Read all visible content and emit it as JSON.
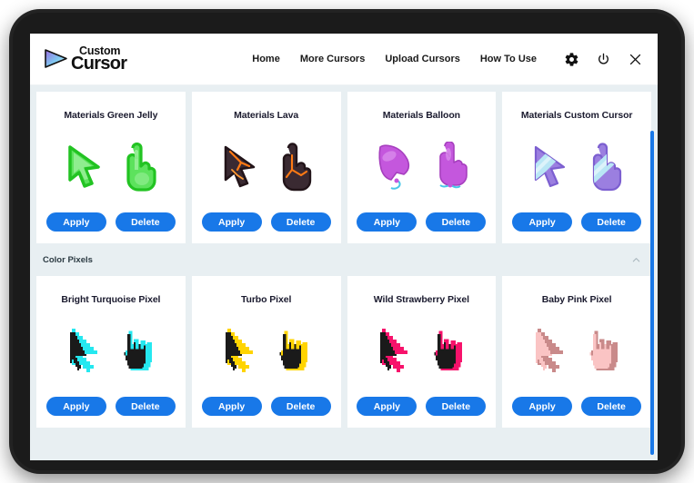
{
  "app": {
    "logo_top": "Custom",
    "logo_bottom": "Cursor"
  },
  "nav": {
    "links": [
      {
        "label": "Home"
      },
      {
        "label": "More Cursors"
      },
      {
        "label": "Upload Cursors"
      },
      {
        "label": "How To Use"
      }
    ],
    "icons": [
      {
        "name": "gear-icon"
      },
      {
        "name": "power-icon"
      },
      {
        "name": "close-icon"
      }
    ]
  },
  "buttons": {
    "apply": "Apply",
    "delete": "Delete",
    "accent_color": "#1878e8"
  },
  "sections": [
    {
      "title": null,
      "cards": [
        {
          "title": "Materials Green Jelly",
          "style": "jelly",
          "fill": "#5de25d",
          "fill_light": "#9cf09c",
          "stroke": "#22c322",
          "apply": "Apply",
          "delete": "Delete"
        },
        {
          "title": "Materials Lava",
          "style": "lava",
          "fill": "#3a2a32",
          "fill_light": "#6b4a50",
          "stroke": "#ff7a14",
          "apply": "Apply",
          "delete": "Delete"
        },
        {
          "title": "Materials Balloon",
          "style": "balloon",
          "fill": "#c457dd",
          "fill_light": "#dd92ee",
          "stroke": "#49c7e8",
          "apply": "Apply",
          "delete": "Delete"
        },
        {
          "title": "Materials Custom Cursor",
          "style": "custom",
          "fill": "#9b7fe0",
          "fill_light": "#b9e6f5",
          "stroke": "#7c5fd0",
          "apply": "Apply",
          "delete": "Delete"
        }
      ]
    },
    {
      "title": "Color Pixels",
      "collapse_icon": "chevron-up-icon",
      "cards": [
        {
          "title": "Bright Turquoise Pixel",
          "style": "pixel",
          "fill": "#1a1a1a",
          "stroke": "#25e8f0",
          "apply": "Apply",
          "delete": "Delete"
        },
        {
          "title": "Turbo Pixel",
          "style": "pixel",
          "fill": "#1a1a1a",
          "stroke": "#ffd400",
          "apply": "Apply",
          "delete": "Delete"
        },
        {
          "title": "Wild Strawberry Pixel",
          "style": "pixel",
          "fill": "#1a1a1a",
          "stroke": "#f7126b",
          "apply": "Apply",
          "delete": "Delete"
        },
        {
          "title": "Baby Pink Pixel",
          "style": "pixel",
          "fill": "#fac4c4",
          "stroke": "#c98a8a",
          "apply": "Apply",
          "delete": "Delete"
        }
      ]
    }
  ]
}
